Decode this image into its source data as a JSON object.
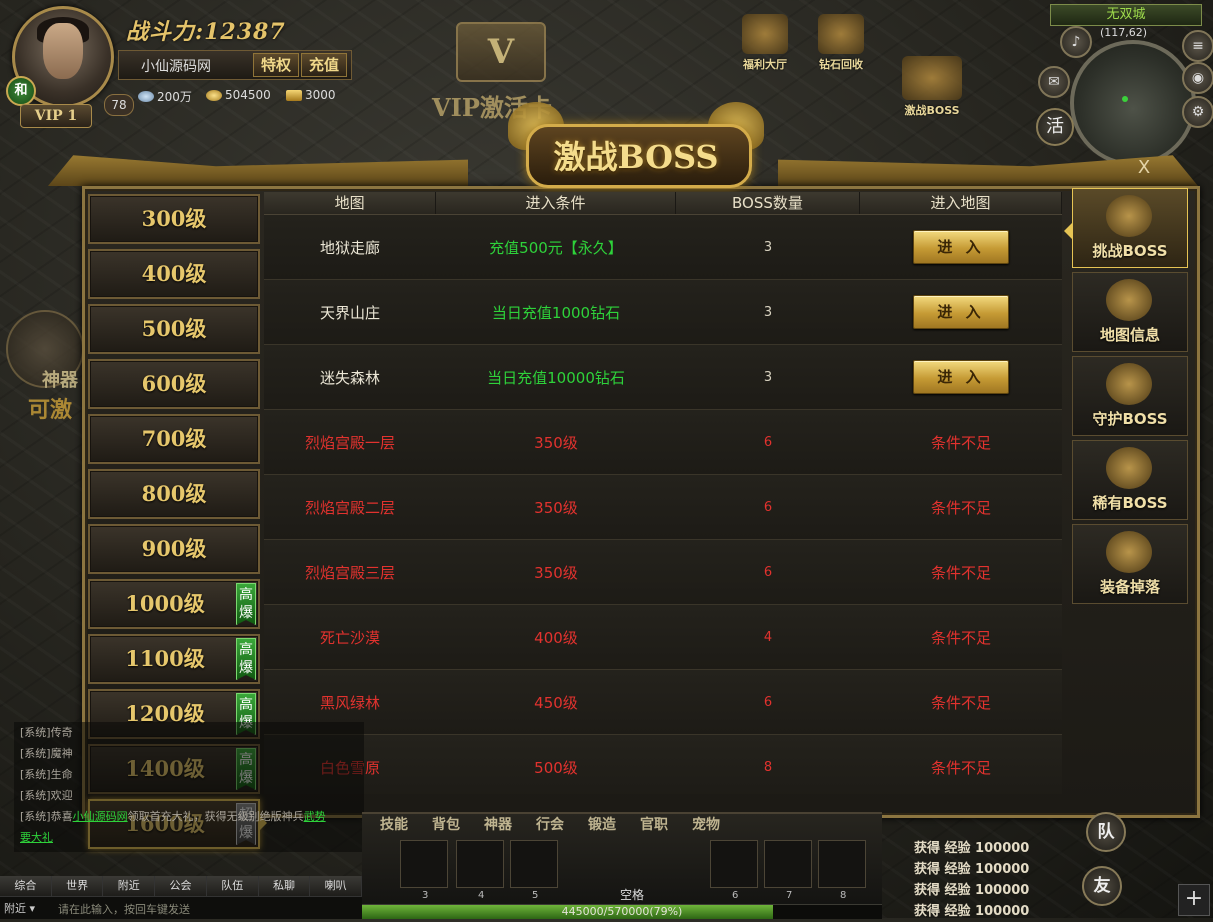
{
  "player": {
    "power": "战斗力:12387",
    "name": "小仙源码网",
    "privilege_label": "特权",
    "recharge_label": "充值",
    "level": "78",
    "vip": "VIP 1",
    "badge": "和",
    "diamonds": "200万",
    "gold": "504500",
    "ingots": "3000"
  },
  "top_icons": {
    "vip_card": "VIP激活卡",
    "welfare": "福利大厅",
    "diamond_recycle": "钻石回收",
    "boss": "激战BOSS"
  },
  "minimap": {
    "zone": "无双城",
    "coords": "(117,62)",
    "huo": "活"
  },
  "side_deco": {
    "shenqi": "神器",
    "activate": "可激"
  },
  "dialog": {
    "title": "激战BOSS",
    "close": "X",
    "levels": [
      {
        "label": "300级",
        "tag": ""
      },
      {
        "label": "400级",
        "tag": ""
      },
      {
        "label": "500级",
        "tag": ""
      },
      {
        "label": "600级",
        "tag": ""
      },
      {
        "label": "700级",
        "tag": ""
      },
      {
        "label": "800级",
        "tag": ""
      },
      {
        "label": "900级",
        "tag": ""
      },
      {
        "label": "1000级",
        "tag": "高爆"
      },
      {
        "label": "1100级",
        "tag": "高爆"
      },
      {
        "label": "1200级",
        "tag": "高爆"
      },
      {
        "label": "1400级",
        "tag": "高爆"
      },
      {
        "label": "1600级",
        "tag": "超爆",
        "active": true
      }
    ],
    "columns": [
      "地图",
      "进入条件",
      "BOSS数量",
      "进入地图"
    ],
    "rows": [
      {
        "map": "地狱走廊",
        "condition": "充值500元【永久】",
        "count": "3",
        "action": "进 入",
        "locked": false
      },
      {
        "map": "天界山庄",
        "condition": "当日充值1000钻石",
        "count": "3",
        "action": "进 入",
        "locked": false
      },
      {
        "map": "迷失森林",
        "condition": "当日充值10000钻石",
        "count": "3",
        "action": "进 入",
        "locked": false
      },
      {
        "map": "烈焰宫殿一层",
        "condition": "350级",
        "count": "6",
        "action": "条件不足",
        "locked": true
      },
      {
        "map": "烈焰宫殿二层",
        "condition": "350级",
        "count": "6",
        "action": "条件不足",
        "locked": true
      },
      {
        "map": "烈焰宫殿三层",
        "condition": "350级",
        "count": "6",
        "action": "条件不足",
        "locked": true
      },
      {
        "map": "死亡沙漠",
        "condition": "400级",
        "count": "4",
        "action": "条件不足",
        "locked": true
      },
      {
        "map": "黑风绿林",
        "condition": "450级",
        "count": "6",
        "action": "条件不足",
        "locked": true
      },
      {
        "map": "白色雪原",
        "condition": "500级",
        "count": "8",
        "action": "条件不足",
        "locked": true
      }
    ],
    "right_tabs": [
      {
        "label": "挑战BOSS",
        "active": true
      },
      {
        "label": "地图信息",
        "active": false
      },
      {
        "label": "守护BOSS",
        "active": false
      },
      {
        "label": "稀有BOSS",
        "active": false
      },
      {
        "label": "装备掉落",
        "active": false
      }
    ]
  },
  "chat": {
    "lines": [
      "[系统]传奇",
      "[系统]魔神",
      "[系统]生命",
      "[系统]欢迎"
    ],
    "last_prefix": "[系统]恭喜",
    "last_link": "小仙源码网",
    "last_mid": "领取首充大礼，获得无级别绝版神兵",
    "last_link2": "武势",
    "last_tail": "要大礼",
    "tabs": [
      "综合",
      "世界",
      "附近",
      "公会",
      "队伍",
      "私聊",
      "喇叭"
    ],
    "channel": "附近",
    "placeholder": "请在此输入，按回车键发送"
  },
  "bottom": {
    "skill_tabs": [
      "技能",
      "背包",
      "神器",
      "行会",
      "锻造",
      "官职",
      "宠物"
    ],
    "slot_numbers": [
      "3",
      "4",
      "5",
      "6",
      "7",
      "8"
    ],
    "space_label": "空格",
    "exp_text": "445000/570000(79%)",
    "exp_ratio": 0.79,
    "log": [
      "获得 经验 100000",
      "获得 经验 100000",
      "获得 经验 100000",
      "获得 经验 100000"
    ],
    "team": "队",
    "friend": "友",
    "plus": "+"
  }
}
